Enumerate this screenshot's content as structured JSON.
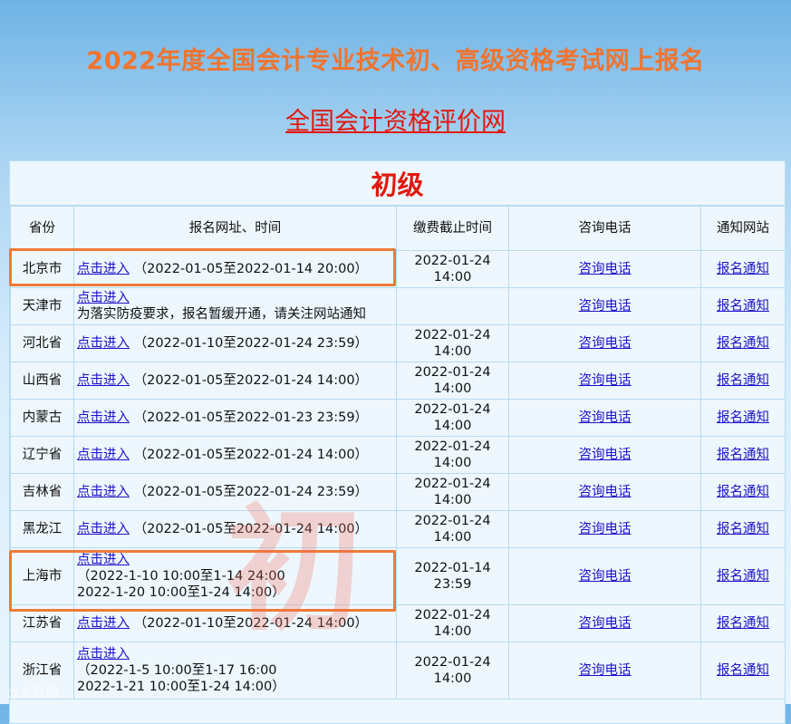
{
  "header": {
    "title": "2022年度全国会计专业技术初、高级资格考试网上报名",
    "site_link": "全国会计资格评价网"
  },
  "section": {
    "title": "初级"
  },
  "columns": [
    "省份",
    "报名网址、时间",
    "缴费截止时间",
    "咨询电话",
    "通知网站"
  ],
  "link_label": "点击进入",
  "phone_label": "咨询电话",
  "notice_label": "报名通知",
  "rows": [
    {
      "province": "北京市",
      "time": "（2022-01-05至2022-01-14 20:00）",
      "deadline1": "2022-01-24",
      "deadline2": "14:00"
    },
    {
      "province": "天津市",
      "note": "为落实防疫要求，报名暂缓开通，请关注网站通知",
      "deadline1": "",
      "deadline2": ""
    },
    {
      "province": "河北省",
      "time": "（2022-01-10至2022-01-24 23:59）",
      "deadline1": "2022-01-24",
      "deadline2": "14:00"
    },
    {
      "province": "山西省",
      "time": "（2022-01-05至2022-01-24 14:00）",
      "deadline1": "2022-01-24",
      "deadline2": "14:00"
    },
    {
      "province": "内蒙古",
      "time": "（2022-01-05至2022-01-23 23:59）",
      "deadline1": "2022-01-24",
      "deadline2": "14:00"
    },
    {
      "province": "辽宁省",
      "time": "（2022-01-05至2022-01-24 14:00）",
      "deadline1": "2022-01-24",
      "deadline2": "14:00"
    },
    {
      "province": "吉林省",
      "time": "（2022-01-05至2022-01-24 23:59）",
      "deadline1": "2022-01-24",
      "deadline2": "14:00"
    },
    {
      "province": "黑龙江",
      "time": "（2022-01-05至2022-01-24 14:00）",
      "deadline1": "2022-01-24",
      "deadline2": "14:00"
    },
    {
      "province": "上海市",
      "time1": "（2022-1-10 10:00至1-14 24:00",
      "time2": "2022-1-20 10:00至1-24 14:00）",
      "deadline1": "2022-01-14",
      "deadline2": "23:59"
    },
    {
      "province": "江苏省",
      "time": "（2022-01-10至2022-01-24 14:00）",
      "deadline1": "2022-01-24",
      "deadline2": "14:00"
    },
    {
      "province": "浙江省",
      "time1": "（2022-1-5 10:00至1-17 16:00",
      "time2": "2022-1-21 10:00至1-24 14:00）",
      "deadline1": "2022-01-24",
      "deadline2": "14:00"
    }
  ],
  "watermark": "初",
  "corner_mark": "@大数据"
}
